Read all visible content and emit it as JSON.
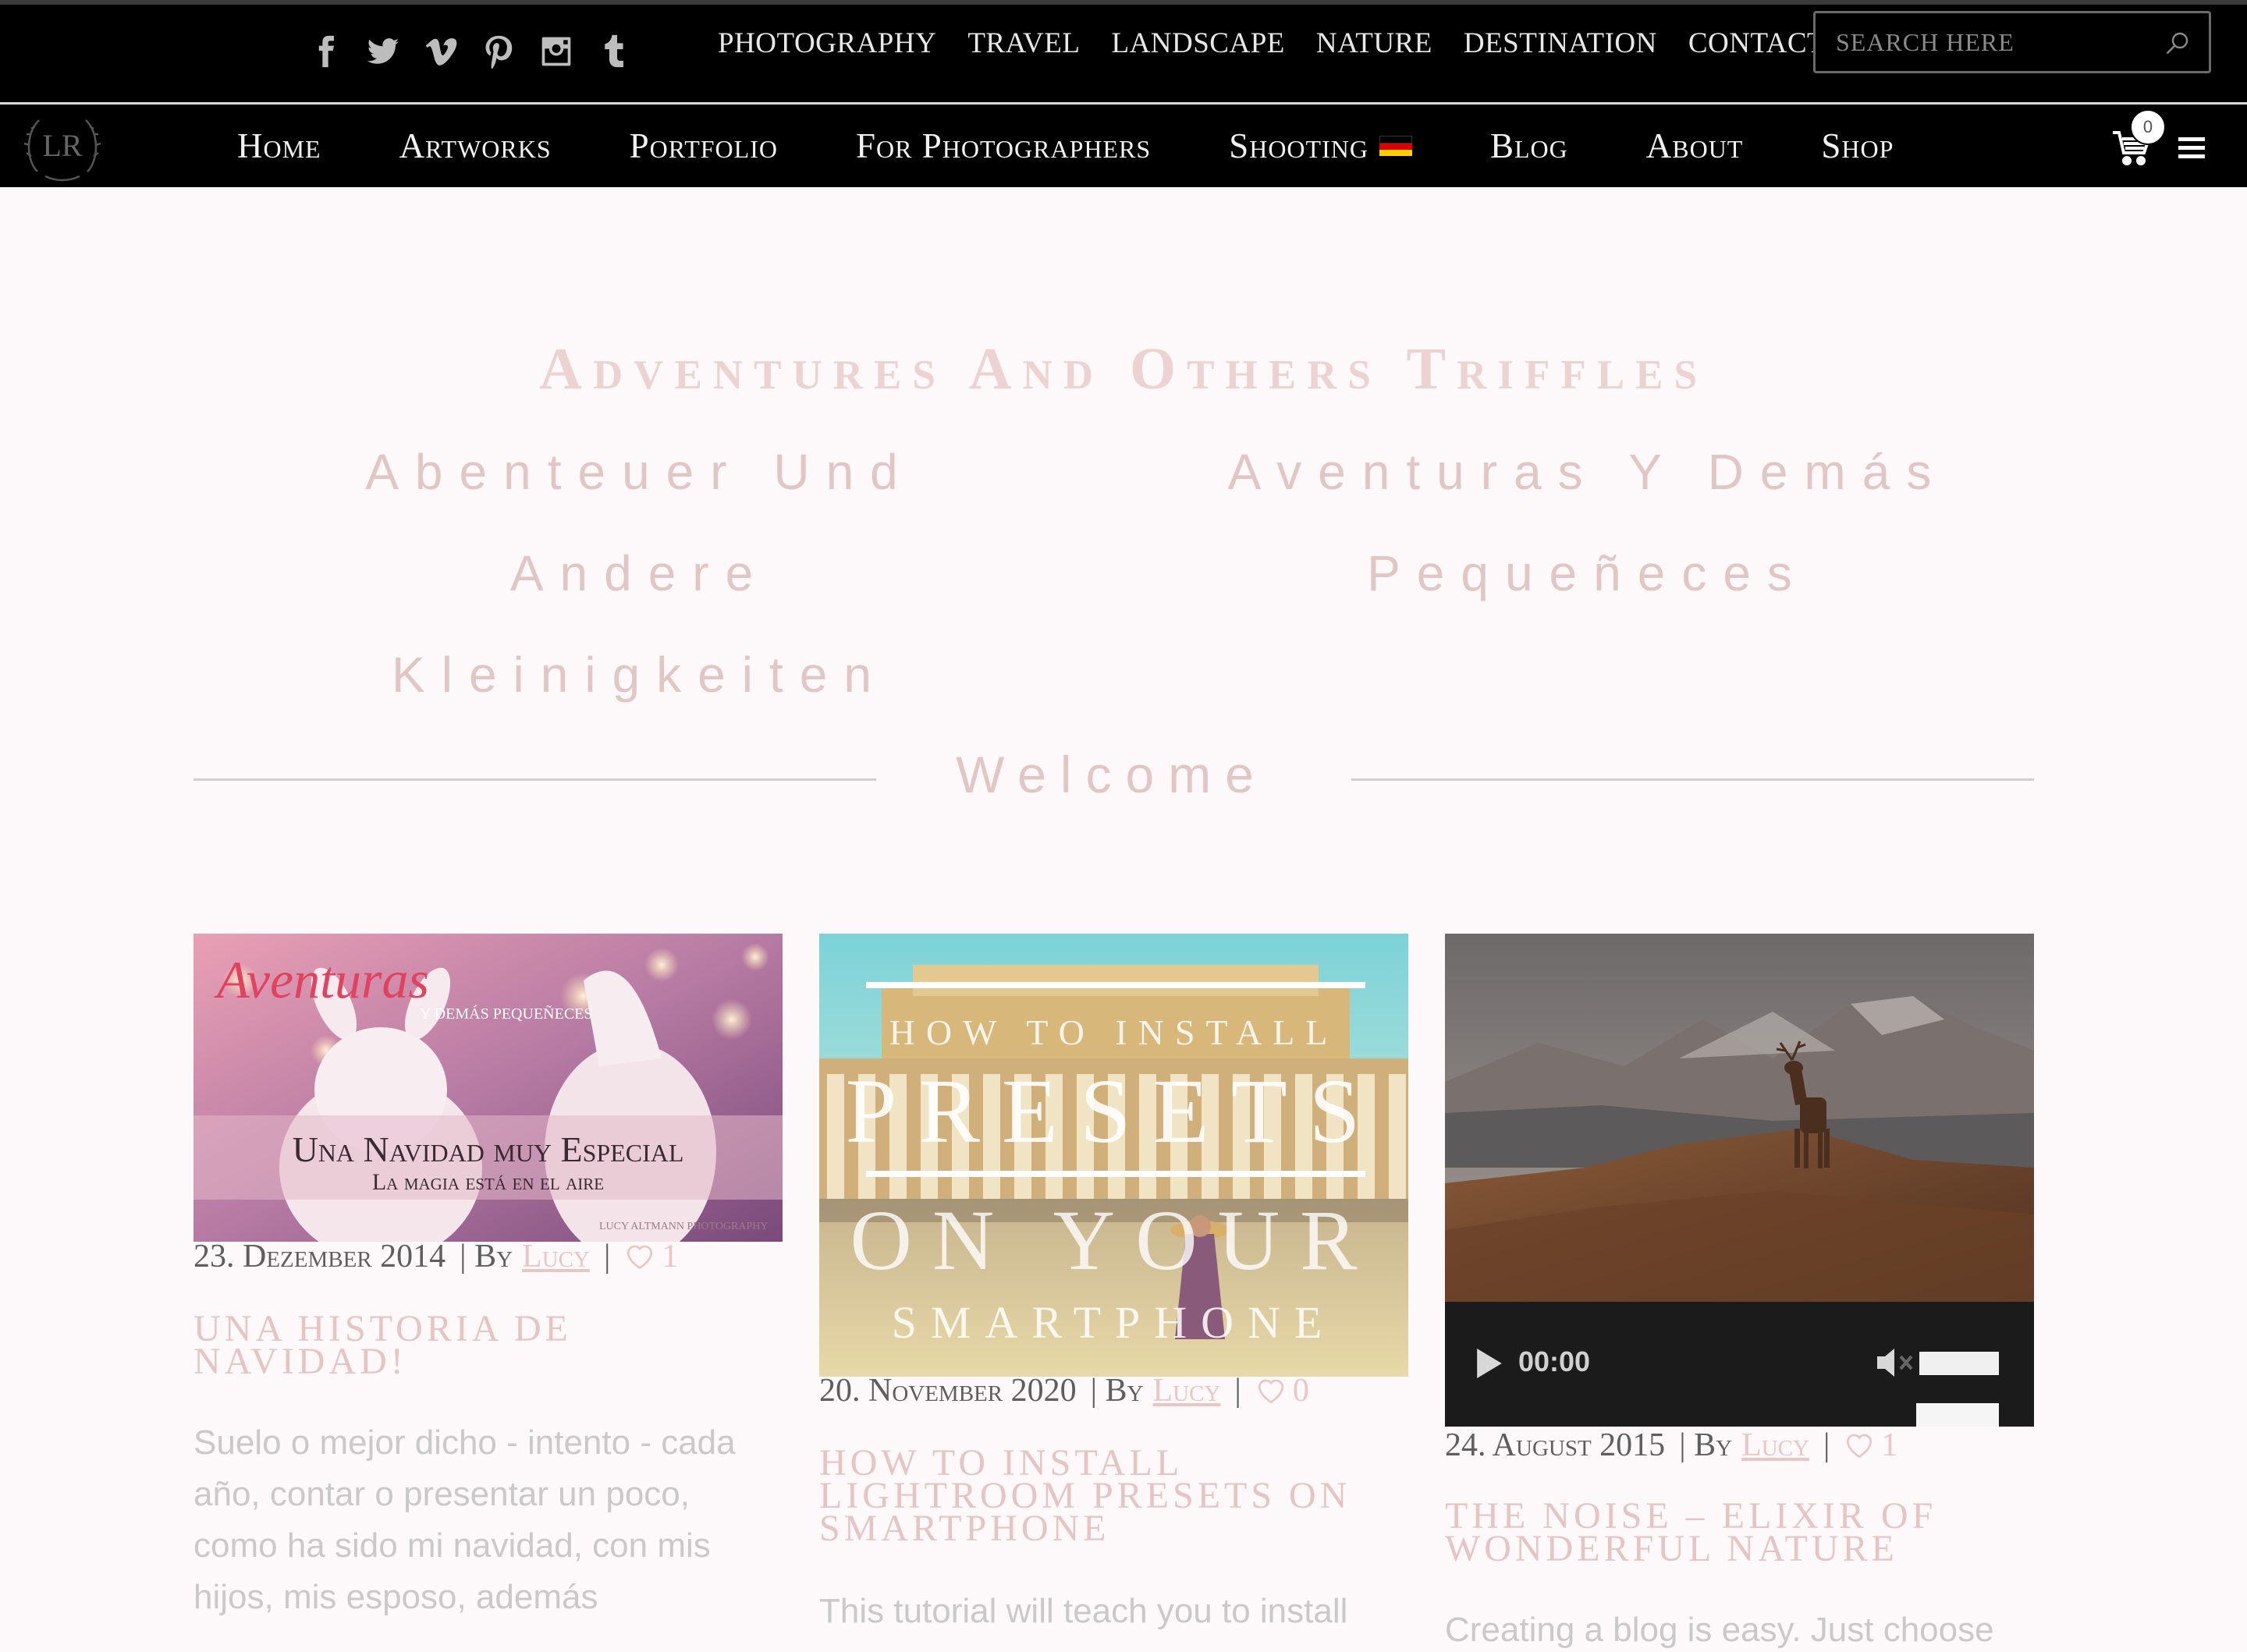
{
  "topbar": {
    "social": [
      "facebook-icon",
      "twitter-icon",
      "vimeo-icon",
      "pinterest-icon",
      "instagram-icon",
      "tumblr-icon"
    ],
    "links": [
      "Photography",
      "Travel",
      "Landscape",
      "Nature",
      "Destination",
      "Contact"
    ],
    "search_placeholder": "Search here"
  },
  "mainnav": {
    "items": [
      "Home",
      "Artworks",
      "Portfolio",
      "For Photographers",
      "Shooting",
      "Blog",
      "About",
      "Shop"
    ],
    "cart_count": "0",
    "logo_letters": "LR"
  },
  "hero": {
    "title": "Adventures And Others Triffles",
    "sub_de_lines": [
      "Abenteuer Und",
      "Andere",
      "Kleinigkeiten"
    ],
    "sub_es_lines": [
      "Aventuras Y Demás",
      "Pequeñeces"
    ],
    "welcome": "Welcome"
  },
  "posts": [
    {
      "image_text": {
        "script": "Aventuras",
        "small": "Y DEMÁS PEQUEÑECES",
        "headline": "Una Navidad muy Especial",
        "sub": "La magia está en el aire",
        "credit": "LUCY ALTMANN PHOTOGRAPHY"
      },
      "date": "23. Dezember 2014",
      "by": "| By",
      "author": "Lucy",
      "likes": "1",
      "title": "Una Historia de Navidad!",
      "excerpt": "Suelo o mejor dicho - intento - cada año, contar o presentar un poco, como ha sido mi navidad, con mis hijos, mis esposo, además"
    },
    {
      "image_text": {
        "line1": "HOW TO INSTALL",
        "line2": "PRESETS",
        "line3": "ON YOUR",
        "line4": "SMARTPHONE"
      },
      "date": "20. November 2020",
      "by": "| By",
      "author": "Lucy",
      "likes": "0",
      "title": "How to install Lightroom Presets on Smartphone",
      "excerpt": "This tutorial will teach you to install"
    },
    {
      "audio_time": "00:00",
      "date": "24. August 2015",
      "by": "| By",
      "author": "Lucy",
      "likes": "1",
      "title": "The Noise – Elixir of Wonderful Nature",
      "excerpt": "Creating a blog is easy. Just choose"
    }
  ],
  "colors": {
    "accent_pink": "#e6c4c3",
    "nav_bg": "#000000",
    "page_bg": "#fdf9fa"
  }
}
